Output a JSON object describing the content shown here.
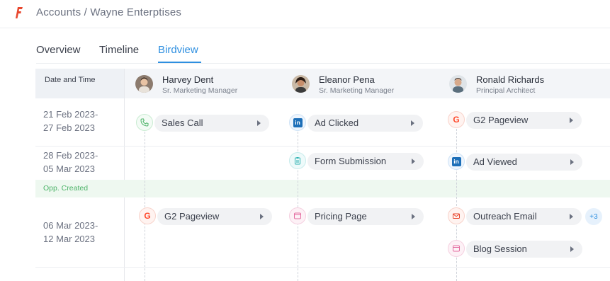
{
  "colors": {
    "accent": "#2e8fe0",
    "opp_green": "#4cb368",
    "logo_red": "#e8472e"
  },
  "header": {
    "breadcrumb": "Accounts / Wayne Enterptises"
  },
  "tabs": [
    {
      "label": "Overview",
      "active": false
    },
    {
      "label": "Timeline",
      "active": false
    },
    {
      "label": "Birdview",
      "active": true
    }
  ],
  "grid": {
    "date_header": "Date and Time",
    "people": [
      {
        "name": "Harvey Dent",
        "role": "Sr. Marketing Manager"
      },
      {
        "name": "Eleanor Pena",
        "role": "Sr. Marketing Manager"
      },
      {
        "name": "Ronald Richards",
        "role": "Principal Architect"
      }
    ],
    "rows": [
      {
        "date_start": "21 Feb 2023-",
        "date_end": "27 Feb 2023"
      },
      {
        "date_start": "28 Feb 2023-",
        "date_end": "05 Mar 2023"
      },
      {
        "date_start": "06 Mar 2023-",
        "date_end": "12 Mar 2023"
      }
    ],
    "opportunity_label": "Opp. Created",
    "events": {
      "harvey": [
        {
          "label": "Sales Call",
          "icon": "phone-icon"
        },
        {
          "label": "G2 Pageview",
          "icon": "g2-icon"
        }
      ],
      "eleanor": [
        {
          "label": "Ad Clicked",
          "icon": "linkedin-icon"
        },
        {
          "label": "Form Submission",
          "icon": "clipboard-icon"
        },
        {
          "label": "Pricing Page",
          "icon": "browser-icon"
        }
      ],
      "ronald": [
        {
          "label": "G2 Pageview",
          "icon": "g2-icon"
        },
        {
          "label": "Ad Viewed",
          "icon": "linkedin-icon"
        },
        {
          "label": "Outreach Email",
          "icon": "mail-icon"
        },
        {
          "label": "Blog Session",
          "icon": "browser-icon"
        }
      ],
      "ronald_more": "+3"
    }
  }
}
